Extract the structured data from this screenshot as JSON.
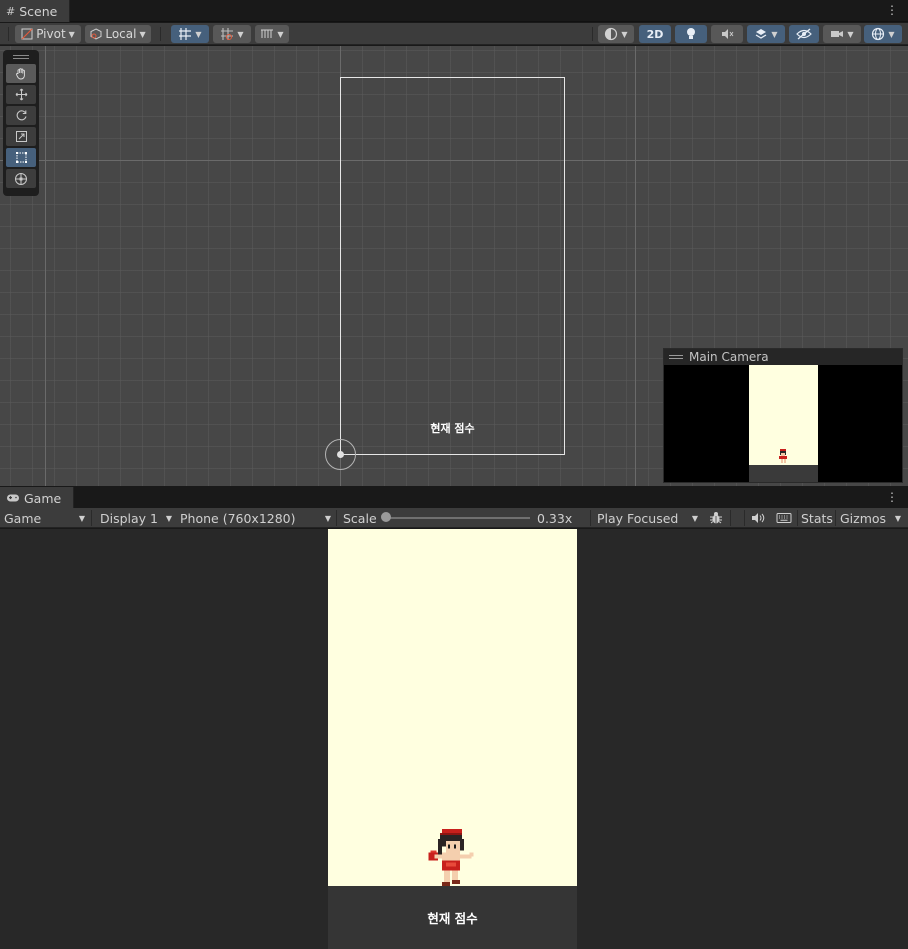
{
  "scene": {
    "tab_title": "Scene",
    "toolbar": {
      "pivot_label": "Pivot",
      "local_label": "Local",
      "view_2d_label": "2D"
    },
    "canvas_text": "현재 점수",
    "camera_preview": {
      "title": "Main Camera"
    },
    "tools": [
      "hand-icon",
      "move-icon",
      "rotate-icon",
      "scale-icon",
      "rect-icon",
      "transform-icon"
    ],
    "active_tool": "rect-icon"
  },
  "game": {
    "tab_title": "Game",
    "toolbar": {
      "view_select": "Game",
      "display_select": "Display 1",
      "resolution_select": "Phone (760x1280)",
      "scale_label": "Scale",
      "scale_value": "0.33x",
      "play_mode_select": "Play Focused",
      "stats_label": "Stats",
      "gizmos_label": "Gizmos"
    },
    "score_text": "현재 점수"
  },
  "colors": {
    "game_background": "#ffffe0",
    "active_blue": "#46607c",
    "editor_dark": "#282828"
  }
}
